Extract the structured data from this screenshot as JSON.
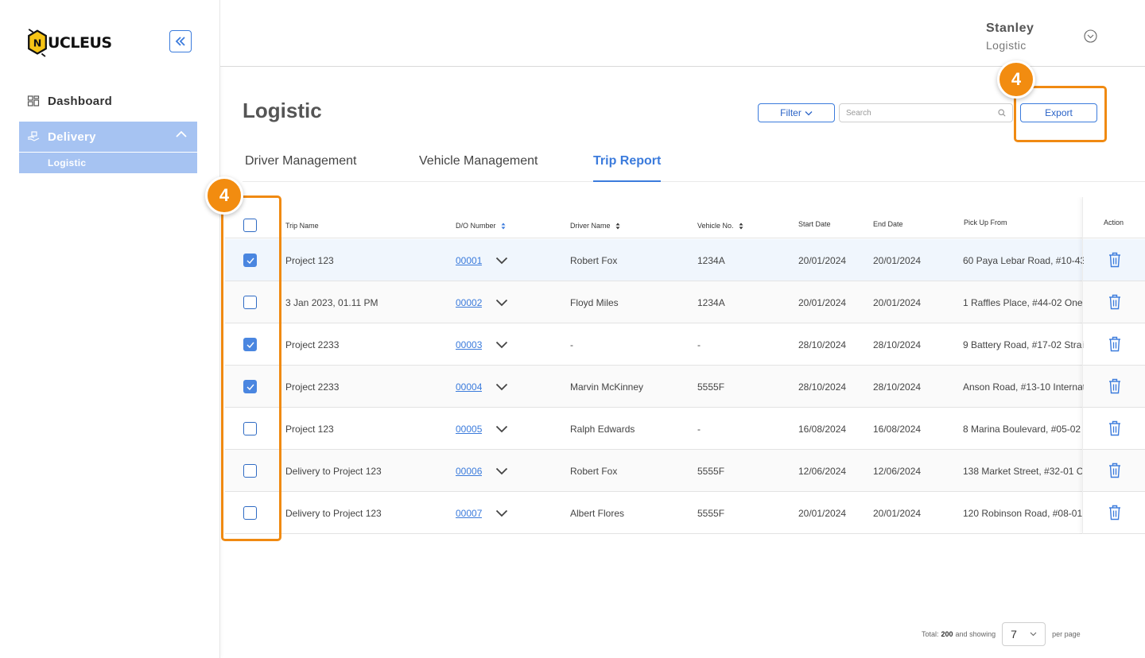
{
  "brand": {
    "logo_letter": "N",
    "logo_text": "UCLEUS"
  },
  "sidebar": {
    "dashboard_label": "Dashboard",
    "delivery_label": "Delivery",
    "logistic_label": "Logistic"
  },
  "header": {
    "user_name": "Stanley",
    "user_role": "Logistic"
  },
  "page": {
    "title": "Logistic"
  },
  "toolbar": {
    "filter_label": "Filter",
    "search_placeholder": "Search",
    "export_label": "Export"
  },
  "annotations": {
    "badge_export": "4",
    "badge_checkbox": "4"
  },
  "tabs": [
    {
      "label": "Driver Management"
    },
    {
      "label": "Vehicle Management"
    },
    {
      "label": "Trip Report"
    }
  ],
  "table": {
    "headers": {
      "trip_name": "Trip Name",
      "do_number": "D/O Number",
      "driver_name": "Driver Name",
      "vehicle_no": "Vehicle No.",
      "start_date": "Start Date",
      "end_date": "End Date",
      "pick_up_from": "Pick Up From",
      "action": "Action"
    },
    "rows": [
      {
        "checked": true,
        "trip": "Project 123",
        "do": "00001",
        "driver": "Robert Fox",
        "vehicle": "1234A",
        "start": "20/01/2024",
        "end": "20/01/2024",
        "pickup": "60 Paya Lebar Road, #10-43"
      },
      {
        "checked": false,
        "trip": "3 Jan 2023, 01.11 PM",
        "do": "00002",
        "driver": "Floyd Miles",
        "vehicle": "1234A",
        "start": "20/01/2024",
        "end": "20/01/2024",
        "pickup": "1 Raffles Place, #44-02 One"
      },
      {
        "checked": true,
        "trip": "Project 2233",
        "do": "00003",
        "driver": "-",
        "vehicle": "-",
        "start": "28/10/2024",
        "end": "28/10/2024",
        "pickup": "9 Battery Road, #17-02 Strai"
      },
      {
        "checked": true,
        "trip": "Project 2233",
        "do": "00004",
        "driver": "Marvin McKinney",
        "vehicle": "5555F",
        "start": "28/10/2024",
        "end": "28/10/2024",
        "pickup": "Anson Road, #13-10 Internat"
      },
      {
        "checked": false,
        "trip": "Project 123",
        "do": "00005",
        "driver": "Ralph Edwards",
        "vehicle": "-",
        "start": "16/08/2024",
        "end": "16/08/2024",
        "pickup": "8 Marina Boulevard, #05-02 I"
      },
      {
        "checked": false,
        "trip": "Delivery to Project 123",
        "do": "00006",
        "driver": "Robert Fox",
        "vehicle": "5555F",
        "start": "12/06/2024",
        "end": "12/06/2024",
        "pickup": "138 Market Street, #32-01 C"
      },
      {
        "checked": false,
        "trip": "Delivery to Project 123",
        "do": "00007",
        "driver": "Albert Flores",
        "vehicle": "5555F",
        "start": "20/01/2024",
        "end": "20/01/2024",
        "pickup": "120 Robinson Road, #08-01"
      }
    ]
  },
  "pagination": {
    "total_prefix": "Total:",
    "total": "200",
    "showing_text": "and showing",
    "page_size": "7",
    "per_page_text": "per page"
  },
  "colors": {
    "accent": "#3b7bdc",
    "highlight": "#f08a12",
    "sidebar_active": "#a6c3f2"
  }
}
